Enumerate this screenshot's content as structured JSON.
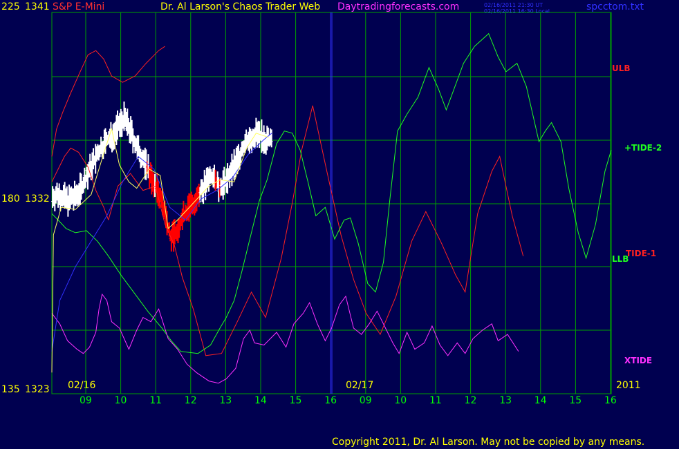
{
  "header": {
    "ticker_left": "225",
    "price_top": "1341",
    "symbol": "S&P E-Mini",
    "title": "Dr. Al Larson's Chaos Trader Web",
    "site": "Daytradingforecasts.com",
    "ts_ut": "02/16/2011 21:30 UT",
    "ts_local": "02/16/2011 16:30 Local",
    "file": "spcctom.txt"
  },
  "colors": {
    "background": "#000050",
    "grid": "#00a000",
    "price_bars": "#ffffff",
    "price_bars_down": "#ff0000",
    "ulb_llb": "#ff2020",
    "tide2": "#20ff20",
    "tide1": "#ff2020",
    "xtide": "#ff30ff",
    "now_line": "#3030ff",
    "yellow_text": "#ffff00"
  },
  "y_axis": {
    "left_labels": [
      {
        "code": "225",
        "price": "1341"
      },
      {
        "code": "180",
        "price": "1332"
      },
      {
        "code": "135",
        "price": "1323"
      }
    ]
  },
  "x_axis": {
    "hour_labels": [
      "09",
      "10",
      "11",
      "12",
      "13",
      "14",
      "15",
      "16",
      "09",
      "10",
      "11",
      "12",
      "13",
      "14",
      "15",
      "16"
    ],
    "dates": [
      "02/16",
      "02/17"
    ],
    "year": "2011"
  },
  "right_labels": {
    "ulb": "ULB",
    "tide2": "+TIDE-2",
    "tide1": "TIDE-1",
    "llb": "LLB",
    "xtide": "XTIDE"
  },
  "footer": "Copyright 2011, Dr. Al Larson. May not be copied by any means.",
  "chart_data": {
    "type": "line",
    "ylim": [
      1323,
      1341
    ],
    "series": [
      {
        "name": "ULB",
        "color": "#ff2020",
        "points": [
          [
            0,
            1334.2
          ],
          [
            0.3,
            1335.5
          ],
          [
            0.7,
            1336.3
          ],
          [
            1.2,
            1337.2
          ],
          [
            1.8,
            1338.2
          ],
          [
            2.3,
            1339.0
          ],
          [
            2.8,
            1339.2
          ],
          [
            3.3,
            1338.8
          ],
          [
            3.8,
            1338.0
          ],
          [
            4.5,
            1337.7
          ],
          [
            5.3,
            1338.0
          ],
          [
            6.0,
            1338.6
          ],
          [
            6.8,
            1339.2
          ],
          [
            7.2,
            1339.4
          ]
        ]
      },
      {
        "name": "LLB",
        "color": "#ff2020",
        "points": [
          [
            0,
            1333.0
          ],
          [
            0.4,
            1333.6
          ],
          [
            0.8,
            1334.2
          ],
          [
            1.2,
            1334.6
          ],
          [
            1.7,
            1334.4
          ],
          [
            2.3,
            1333.7
          ],
          [
            2.8,
            1332.6
          ],
          [
            3.3,
            1331.8
          ],
          [
            3.6,
            1331.2
          ]
        ]
      },
      {
        "name": "TIDE-1",
        "color": "#ff2020",
        "points": [
          [
            3.6,
            1331.2
          ],
          [
            4.2,
            1332.8
          ],
          [
            5.0,
            1333.4
          ],
          [
            5.8,
            1332.6
          ],
          [
            6.6,
            1332.8
          ],
          [
            7.2,
            1331.0
          ],
          [
            7.8,
            1330.0
          ],
          [
            8.3,
            1328.5
          ],
          [
            9.0,
            1327.0
          ],
          [
            9.8,
            1324.8
          ],
          [
            10.8,
            1324.9
          ],
          [
            11.8,
            1326.4
          ],
          [
            12.7,
            1327.8
          ],
          [
            13.6,
            1326.6
          ],
          [
            14.6,
            1329.4
          ],
          [
            15.3,
            1332.0
          ],
          [
            15.9,
            1334.5
          ],
          [
            16.6,
            1336.6
          ],
          [
            17.5,
            1333.5
          ],
          [
            18.4,
            1330.5
          ],
          [
            19.2,
            1328.4
          ],
          [
            20.0,
            1326.8
          ],
          [
            20.9,
            1325.8
          ],
          [
            21.9,
            1327.6
          ],
          [
            22.9,
            1330.2
          ],
          [
            23.8,
            1331.6
          ],
          [
            24.8,
            1330.1
          ],
          [
            25.7,
            1328.6
          ],
          [
            26.3,
            1327.8
          ],
          [
            27.1,
            1331.5
          ],
          [
            28.0,
            1333.5
          ],
          [
            28.5,
            1334.2
          ],
          [
            29.3,
            1331.4
          ],
          [
            30.0,
            1329.5
          ]
        ]
      },
      {
        "name": "+TIDE-2",
        "color": "#20ff20",
        "points": [
          [
            0,
            1331.5
          ],
          [
            0.4,
            1331.2
          ],
          [
            0.9,
            1330.8
          ],
          [
            1.5,
            1330.6
          ],
          [
            2.2,
            1330.7
          ],
          [
            2.9,
            1330.2
          ],
          [
            3.6,
            1329.5
          ],
          [
            4.4,
            1328.6
          ],
          [
            5.2,
            1327.8
          ],
          [
            6.1,
            1326.9
          ],
          [
            7.0,
            1326.1
          ],
          [
            7.6,
            1325.5
          ],
          [
            8.2,
            1325.0
          ],
          [
            9.3,
            1324.9
          ],
          [
            10.1,
            1325.3
          ],
          [
            10.7,
            1326.1
          ],
          [
            11.1,
            1326.6
          ],
          [
            11.6,
            1327.4
          ],
          [
            12.1,
            1328.8
          ],
          [
            12.6,
            1330.3
          ],
          [
            13.2,
            1332.1
          ],
          [
            13.7,
            1333.1
          ],
          [
            14.3,
            1334.8
          ],
          [
            14.8,
            1335.4
          ],
          [
            15.3,
            1335.3
          ],
          [
            15.8,
            1334.5
          ],
          [
            16.3,
            1333.0
          ],
          [
            16.8,
            1331.4
          ],
          [
            17.4,
            1331.8
          ],
          [
            18.0,
            1330.3
          ],
          [
            18.6,
            1331.2
          ],
          [
            19.0,
            1331.3
          ],
          [
            19.5,
            1330.1
          ],
          [
            20.1,
            1328.2
          ],
          [
            20.6,
            1327.8
          ],
          [
            21.1,
            1329.2
          ],
          [
            21.5,
            1332.1
          ],
          [
            22.0,
            1335.4
          ],
          [
            22.6,
            1336.2
          ],
          [
            23.3,
            1337.0
          ],
          [
            24.0,
            1338.4
          ],
          [
            24.6,
            1337.4
          ],
          [
            25.1,
            1336.4
          ],
          [
            25.6,
            1337.4
          ],
          [
            26.2,
            1338.6
          ],
          [
            26.9,
            1339.4
          ],
          [
            27.8,
            1340.0
          ],
          [
            28.4,
            1338.9
          ],
          [
            28.9,
            1338.2
          ],
          [
            29.6,
            1338.6
          ],
          [
            30.2,
            1337.5
          ],
          [
            31.0,
            1334.9
          ],
          [
            31.4,
            1335.4
          ],
          [
            31.8,
            1335.8
          ],
          [
            32.4,
            1334.9
          ],
          [
            32.9,
            1332.7
          ],
          [
            33.5,
            1330.6
          ],
          [
            34.0,
            1329.4
          ],
          [
            34.6,
            1331.0
          ],
          [
            35.2,
            1333.5
          ],
          [
            35.6,
            1334.5
          ]
        ]
      },
      {
        "name": "XTIDE",
        "color": "#ff30ff",
        "points": [
          [
            0,
            1326.8
          ],
          [
            0.5,
            1326.3
          ],
          [
            1.0,
            1325.5
          ],
          [
            1.6,
            1325.1
          ],
          [
            2.0,
            1324.9
          ],
          [
            2.4,
            1325.2
          ],
          [
            2.8,
            1325.9
          ],
          [
            3.0,
            1327.0
          ],
          [
            3.2,
            1327.7
          ],
          [
            3.5,
            1327.4
          ],
          [
            3.8,
            1326.4
          ],
          [
            4.3,
            1326.1
          ],
          [
            4.9,
            1325.1
          ],
          [
            5.4,
            1326.0
          ],
          [
            5.8,
            1326.6
          ],
          [
            6.3,
            1326.4
          ],
          [
            6.8,
            1327.0
          ],
          [
            7.4,
            1325.6
          ],
          [
            8.0,
            1325.1
          ],
          [
            8.6,
            1324.4
          ],
          [
            9.2,
            1324.0
          ],
          [
            10.0,
            1323.6
          ],
          [
            10.6,
            1323.5
          ],
          [
            11.1,
            1323.7
          ],
          [
            11.7,
            1324.2
          ],
          [
            12.2,
            1325.6
          ],
          [
            12.6,
            1326.0
          ],
          [
            12.9,
            1325.4
          ],
          [
            13.5,
            1325.3
          ],
          [
            14.3,
            1325.9
          ],
          [
            14.9,
            1325.2
          ],
          [
            15.4,
            1326.3
          ],
          [
            16.0,
            1326.8
          ],
          [
            16.4,
            1327.3
          ],
          [
            16.9,
            1326.3
          ],
          [
            17.4,
            1325.5
          ],
          [
            17.8,
            1326.1
          ],
          [
            18.3,
            1327.2
          ],
          [
            18.7,
            1327.6
          ],
          [
            19.2,
            1326.1
          ],
          [
            19.7,
            1325.8
          ],
          [
            20.2,
            1326.3
          ],
          [
            20.7,
            1326.9
          ],
          [
            21.3,
            1326.0
          ],
          [
            21.7,
            1325.4
          ],
          [
            22.1,
            1324.9
          ],
          [
            22.6,
            1325.9
          ],
          [
            23.1,
            1325.1
          ],
          [
            23.7,
            1325.4
          ],
          [
            24.2,
            1326.2
          ],
          [
            24.7,
            1325.3
          ],
          [
            25.2,
            1324.8
          ],
          [
            25.8,
            1325.4
          ],
          [
            26.3,
            1324.9
          ],
          [
            26.8,
            1325.6
          ],
          [
            27.4,
            1326.0
          ],
          [
            28.0,
            1326.3
          ],
          [
            28.4,
            1325.5
          ],
          [
            29.0,
            1325.8
          ],
          [
            29.7,
            1325.0
          ]
        ]
      },
      {
        "name": "Price",
        "color": "#ffffff",
        "points": [
          [
            0,
            1332.3
          ],
          [
            0.5,
            1332.4
          ],
          [
            1.0,
            1332.1
          ],
          [
            1.5,
            1332.3
          ],
          [
            2.0,
            1332.9
          ],
          [
            2.5,
            1333.7
          ],
          [
            3.0,
            1334.4
          ],
          [
            3.4,
            1334.9
          ],
          [
            3.8,
            1335.1
          ],
          [
            4.2,
            1335.6
          ],
          [
            4.6,
            1336.0
          ],
          [
            5.0,
            1335.4
          ],
          [
            5.4,
            1334.6
          ],
          [
            5.8,
            1334.1
          ],
          [
            6.1,
            1333.6
          ],
          [
            6.4,
            1333.1
          ],
          [
            6.6,
            1332.8
          ],
          [
            6.9,
            1332.4
          ],
          [
            7.2,
            1331.6
          ],
          [
            7.4,
            1330.8
          ],
          [
            7.6,
            1330.3
          ],
          [
            7.9,
            1330.7
          ],
          [
            8.2,
            1331.1
          ],
          [
            8.5,
            1331.5
          ],
          [
            8.8,
            1331.8
          ],
          [
            9.1,
            1332.1
          ],
          [
            9.4,
            1332.5
          ],
          [
            9.8,
            1332.9
          ],
          [
            10.1,
            1333.2
          ],
          [
            10.4,
            1333.0
          ],
          [
            10.7,
            1332.8
          ],
          [
            11.0,
            1333.0
          ],
          [
            11.4,
            1333.5
          ],
          [
            11.8,
            1334.0
          ],
          [
            12.1,
            1334.5
          ],
          [
            12.4,
            1334.9
          ],
          [
            12.7,
            1335.1
          ],
          [
            13.0,
            1335.3
          ],
          [
            13.3,
            1335.2
          ],
          [
            13.6,
            1335.0
          ],
          [
            14.0,
            1334.9
          ]
        ]
      }
    ]
  }
}
